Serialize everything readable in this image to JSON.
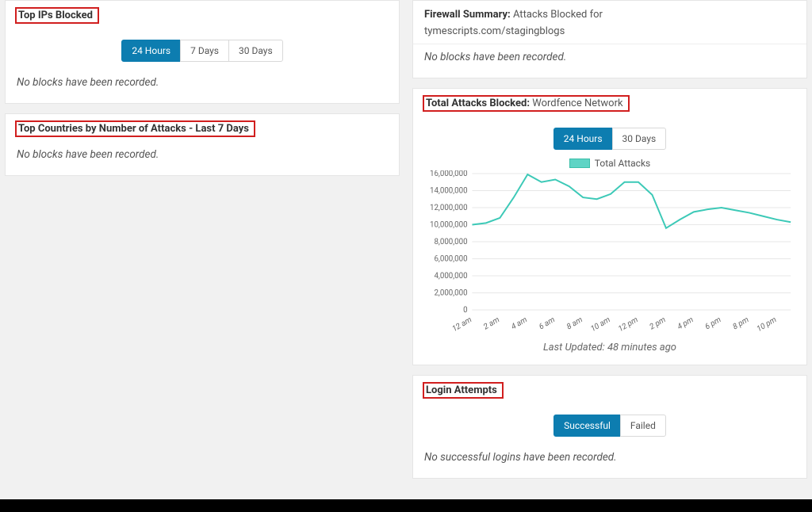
{
  "left": {
    "topIPs": {
      "title": "Top IPs Blocked",
      "tabs": {
        "t24": "24 Hours",
        "t7": "7 Days",
        "t30": "30 Days",
        "active": "t24"
      },
      "empty": "No blocks have been recorded."
    },
    "topCountries": {
      "title": "Top Countries by Number of Attacks - Last 7 Days",
      "empty": "No blocks have been recorded."
    }
  },
  "right": {
    "firewall": {
      "title_bold": "Firewall Summary:",
      "title_rest": "Attacks Blocked for",
      "site": "tymescripts.com/stagingblogs",
      "empty": "No blocks have been recorded."
    },
    "totalAttacks": {
      "title_bold": "Total Attacks Blocked:",
      "title_rest": "Wordfence Network",
      "tabs": {
        "t24": "24 Hours",
        "t30": "30 Days",
        "active": "t24"
      },
      "legend": "Total Attacks",
      "updated": "Last Updated: 48 minutes ago"
    },
    "login": {
      "title": "Login Attempts",
      "tabs": {
        "succ": "Successful",
        "fail": "Failed",
        "active": "succ"
      },
      "empty": "No successful logins have been recorded."
    }
  },
  "chart_data": {
    "type": "line",
    "title": "Total Attacks Blocked: Wordfence Network",
    "xlabel": "",
    "ylabel": "",
    "ylim": [
      0,
      16000000
    ],
    "y_ticks": [
      0,
      2000000,
      4000000,
      6000000,
      8000000,
      10000000,
      12000000,
      14000000,
      16000000
    ],
    "y_tick_labels": [
      "0",
      "2,000,000",
      "4,000,000",
      "6,000,000",
      "8,000,000",
      "10,000,000",
      "12,000,000",
      "14,000,000",
      "16,000,000"
    ],
    "categories": [
      "12 am",
      "1 am",
      "2 am",
      "3 am",
      "4 am",
      "5 am",
      "6 am",
      "7 am",
      "8 am",
      "9 am",
      "10 am",
      "11 am",
      "12 pm",
      "1 pm",
      "2 pm",
      "3 pm",
      "4 pm",
      "5 pm",
      "6 pm",
      "7 pm",
      "8 pm",
      "9 pm",
      "10 pm",
      "11 pm"
    ],
    "x_tick_labels": [
      "12 am",
      "2 am",
      "4 am",
      "6 am",
      "8 am",
      "10 am",
      "12 pm",
      "2 pm",
      "4 pm",
      "6 pm",
      "8 pm",
      "10 pm"
    ],
    "series": [
      {
        "name": "Total Attacks",
        "values": [
          10000000,
          10200000,
          10800000,
          13200000,
          15900000,
          15000000,
          15300000,
          14500000,
          13200000,
          13000000,
          13600000,
          15000000,
          15000000,
          13500000,
          9600000,
          10600000,
          11500000,
          11800000,
          12000000,
          11700000,
          11400000,
          11000000,
          10600000,
          10300000
        ]
      }
    ]
  }
}
